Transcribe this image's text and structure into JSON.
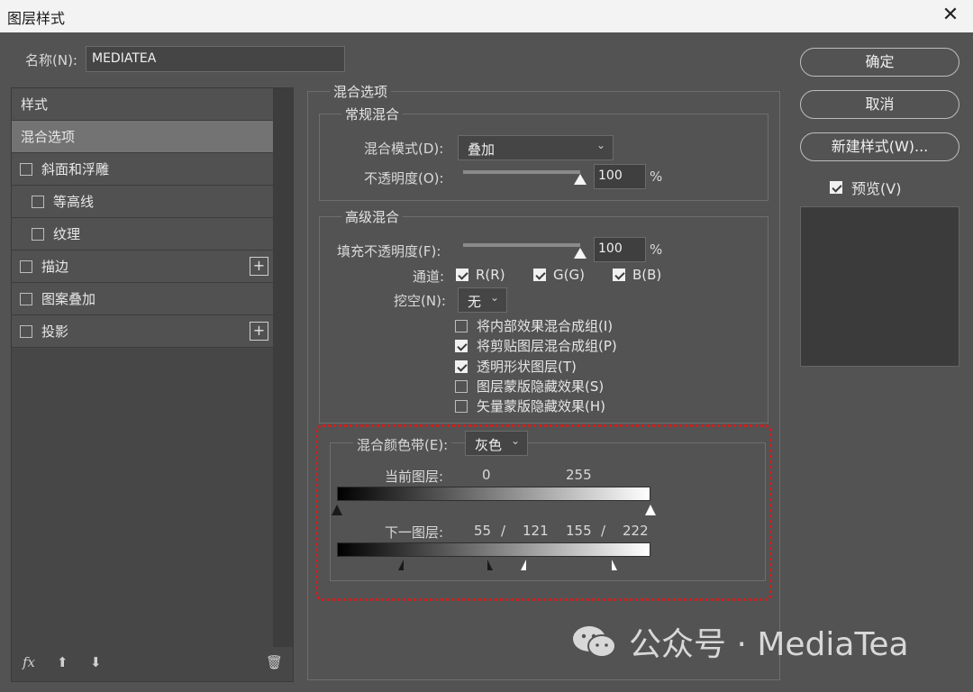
{
  "window": {
    "title": "图层样式"
  },
  "name_field": {
    "label": "名称(N):",
    "value": "MEDIATEA"
  },
  "style_panel": {
    "header": "样式",
    "items": [
      {
        "label": "混合选项",
        "selected": true
      },
      {
        "label": "斜面和浮雕",
        "checked": false
      },
      {
        "label": "等高线",
        "checked": false
      },
      {
        "label": "纹理",
        "checked": false
      },
      {
        "label": "描边",
        "checked": false
      },
      {
        "label": "图案叠加",
        "checked": false
      },
      {
        "label": "投影",
        "checked": false
      }
    ],
    "footer": {
      "fx": "fx",
      "up": "⬆",
      "down": "⬇",
      "trash": "🗑"
    }
  },
  "blend_options": {
    "section_title": "混合选项",
    "general": {
      "title": "常规混合",
      "mode_label": "混合模式(D):",
      "mode_value": "叠加",
      "opacity_label": "不透明度(O):",
      "opacity_value": "100",
      "opacity_unit": "%"
    },
    "advanced": {
      "title": "高级混合",
      "fill_label": "填充不透明度(F):",
      "fill_value": "100",
      "fill_unit": "%",
      "channels_label": "通道:",
      "channels": [
        {
          "label": "R(R)",
          "checked": true
        },
        {
          "label": "G(G)",
          "checked": true
        },
        {
          "label": "B(B)",
          "checked": true
        }
      ],
      "knockout_label": "挖空(N):",
      "knockout_value": "无",
      "options": [
        {
          "label": "将内部效果混合成组(I)",
          "checked": false
        },
        {
          "label": "将剪贴图层混合成组(P)",
          "checked": true
        },
        {
          "label": "透明形状图层(T)",
          "checked": true
        },
        {
          "label": "图层蒙版隐藏效果(S)",
          "checked": false
        },
        {
          "label": "矢量蒙版隐藏效果(H)",
          "checked": false
        }
      ]
    },
    "blend_if": {
      "label": "混合颜色带(E):",
      "value": "灰色",
      "this_layer_label": "当前图层:",
      "this_layer_values": [
        "0",
        "255"
      ],
      "underlying_label": "下一图层:",
      "underlying_values": [
        "55",
        "/",
        "121",
        "155",
        "/",
        "222"
      ]
    }
  },
  "buttons": {
    "ok": "确定",
    "cancel": "取消",
    "new_style": "新建样式(W)...",
    "preview_label": "预览(V)",
    "preview_checked": true
  },
  "watermark": {
    "text": "公众号 · MediaTea"
  }
}
